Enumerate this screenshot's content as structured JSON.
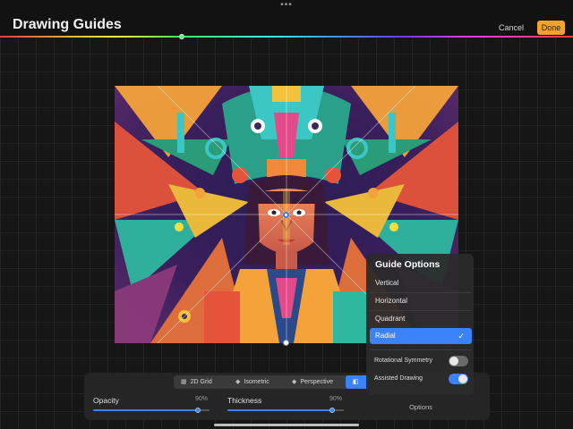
{
  "header": {
    "title": "Drawing Guides",
    "cancel_label": "Cancel",
    "done_label": "Done",
    "more_icon": "ellipsis-icon",
    "accent_color": "#f4a22e"
  },
  "guide_modes": [
    {
      "label": "2D Grid",
      "icon": "grid-icon"
    },
    {
      "label": "Isometric",
      "icon": "isometric-icon"
    },
    {
      "label": "Perspective",
      "icon": "perspective-icon"
    },
    {
      "label": "",
      "icon": "symmetry-icon",
      "selected": true
    }
  ],
  "sliders": {
    "opacity": {
      "label": "Opacity",
      "value_text": "90%",
      "value": 0.9
    },
    "thickness": {
      "label": "Thickness",
      "value_text": "90%",
      "value": 0.9
    }
  },
  "options_label": "Options",
  "guide_options": {
    "title": "Guide Options",
    "items": [
      {
        "label": "Vertical",
        "selected": false
      },
      {
        "label": "Horizontal",
        "selected": false
      },
      {
        "label": "Quadrant",
        "selected": false
      },
      {
        "label": "Radial",
        "selected": true
      }
    ],
    "toggles": [
      {
        "label": "Rotational Symmetry",
        "on": false
      },
      {
        "label": "Assisted Drawing",
        "on": true
      }
    ],
    "selected_color": "#3b82f6"
  }
}
